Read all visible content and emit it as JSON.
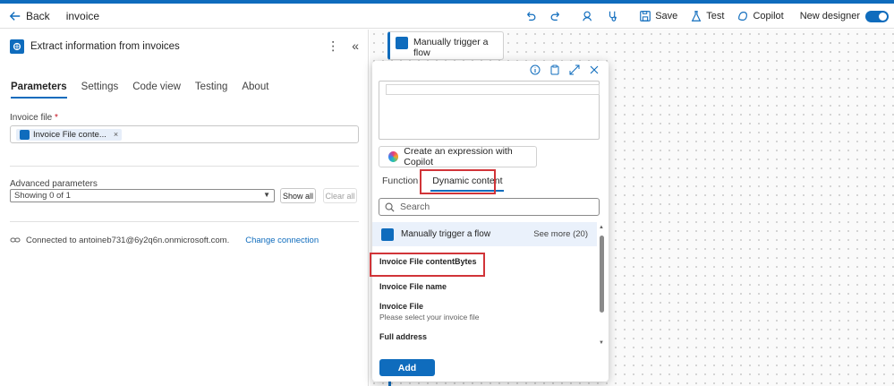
{
  "topbar": {
    "back_label": "Back",
    "flow_name": "invoice",
    "save_label": "Save",
    "test_label": "Test",
    "copilot_label": "Copilot",
    "new_designer_label": "New designer",
    "new_designer_on": true,
    "accent_color": "#0f6cbd"
  },
  "panel": {
    "title": "Extract information from invoices",
    "tabs": [
      {
        "label": "Parameters",
        "active": true
      },
      {
        "label": "Settings",
        "active": false
      },
      {
        "label": "Code view",
        "active": false
      },
      {
        "label": "Testing",
        "active": false
      },
      {
        "label": "About",
        "active": false
      }
    ],
    "invoice_file_label": "Invoice file",
    "required_mark": "*",
    "invoice_file_token": "Invoice File conte...",
    "token_remove": "×",
    "advanced_label": "Advanced parameters",
    "advanced_value": "Showing 0 of 1",
    "show_all_label": "Show all",
    "clear_all_label": "Clear all",
    "connection_text": "Connected to antoineb731@6y2q6n.onmicrosoft.com.",
    "change_connection_label": "Change connection"
  },
  "canvas": {
    "trigger_card_title": "Manually trigger a flow"
  },
  "popup": {
    "copilot_button_label": "Create an expression with Copilot",
    "tabs": [
      {
        "label": "Function",
        "active": false
      },
      {
        "label": "Dynamic content",
        "active": true
      }
    ],
    "search_placeholder": "Search",
    "group_title": "Manually trigger a flow",
    "see_more_label": "See more (20)",
    "items": [
      {
        "title": "Invoice File contentBytes",
        "subtitle": ""
      },
      {
        "title": "Invoice File name",
        "subtitle": ""
      },
      {
        "title": "Invoice File",
        "subtitle": "Please select your invoice file"
      },
      {
        "title": "Full address",
        "subtitle": ""
      }
    ],
    "add_label": "Add",
    "highlight_color": "#d13438"
  }
}
